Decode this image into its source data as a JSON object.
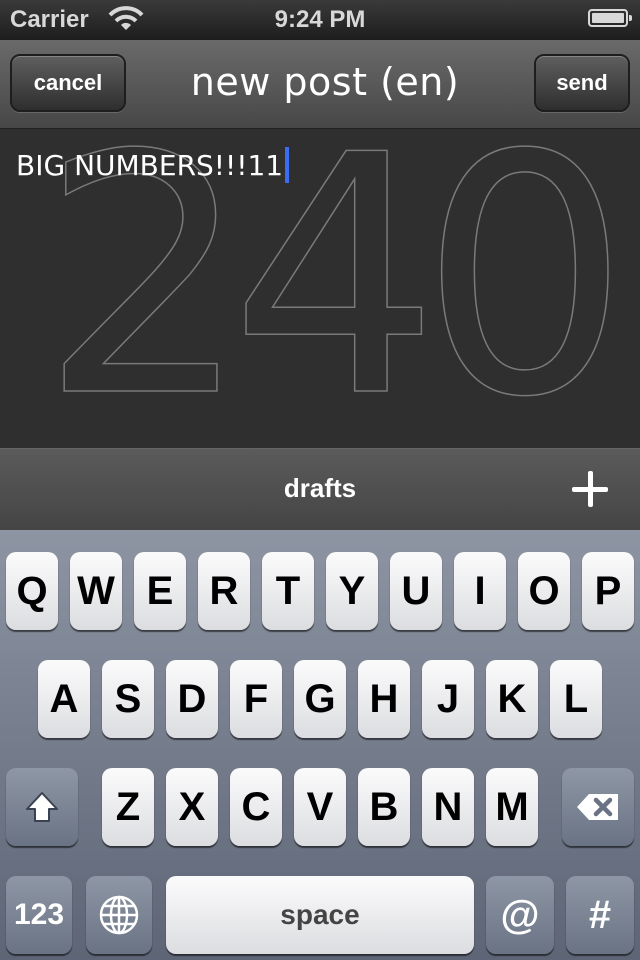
{
  "status_bar": {
    "carrier": "Carrier",
    "time": "9:24 PM"
  },
  "nav": {
    "cancel_label": "cancel",
    "title": "new post (en)",
    "send_label": "send"
  },
  "editor": {
    "counter": "240",
    "text": "BIG NUMBERS!!!11"
  },
  "drafts": {
    "label": "drafts"
  },
  "keyboard": {
    "row1": [
      "Q",
      "W",
      "E",
      "R",
      "T",
      "Y",
      "U",
      "I",
      "O",
      "P"
    ],
    "row2": [
      "A",
      "S",
      "D",
      "F",
      "G",
      "H",
      "J",
      "K",
      "L"
    ],
    "row3": [
      "Z",
      "X",
      "C",
      "V",
      "B",
      "N",
      "M"
    ],
    "numbers_label": "123",
    "space_label": "space",
    "at_label": "@",
    "hash_label": "#"
  },
  "colors": {
    "caret": "#3b6cf2",
    "keyboard_bg": "#7a8291",
    "nav_bg": "#5a5a5a"
  }
}
